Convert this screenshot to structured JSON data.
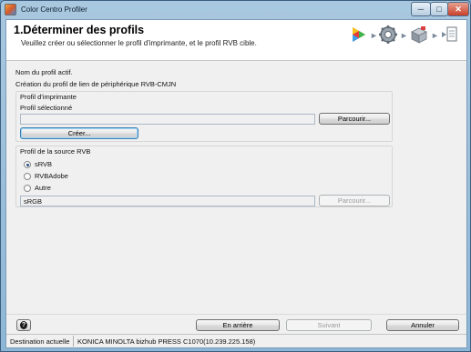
{
  "window": {
    "title": "Color Centro Profiler",
    "minimize": "─",
    "maximize": "□",
    "close": "✕"
  },
  "header": {
    "title": "1.Déterminer des profils",
    "subtitle": "Veuillez créer ou sélectionner le profil d'imprimante, et le profil RVB cible.",
    "step_arrow": "►",
    "step_icons": [
      "play-color-icon",
      "gear-icon",
      "printer-cube-icon",
      "document-arrow-icon"
    ]
  },
  "info": {
    "profile_name_label": "Nom du profil actif.",
    "creation_label": "Création du profil de lien de périphérique RVB-CMJN"
  },
  "printer_profile": {
    "group_label": "Profil d'imprimante",
    "selected_label": "Profil sélectionné",
    "selected_value": "",
    "browse_button": "Parcourir...",
    "create_button": "Créer..."
  },
  "rgb_source": {
    "group_label": "Profil de la source RVB",
    "options": [
      {
        "label": "sRVB",
        "checked": true
      },
      {
        "label": "RVBAdobe",
        "checked": false
      },
      {
        "label": "Autre",
        "checked": false
      }
    ],
    "path_value": "sRGB",
    "browse_button": "Parcourir..."
  },
  "footer": {
    "help_glyph": "?",
    "back_button": "En arrière",
    "next_button": "Suivant",
    "cancel_button": "Annuler"
  },
  "status": {
    "label": "Destination actuelle",
    "value": "KONICA MINOLTA bizhub PRESS C1070(10.239.225.158)"
  },
  "colors": {
    "title_bar": "#8db6d6",
    "header_bg": "#ffffff",
    "dialog_bg": "#f0f0f0",
    "focus_border": "#3c7fb1"
  }
}
